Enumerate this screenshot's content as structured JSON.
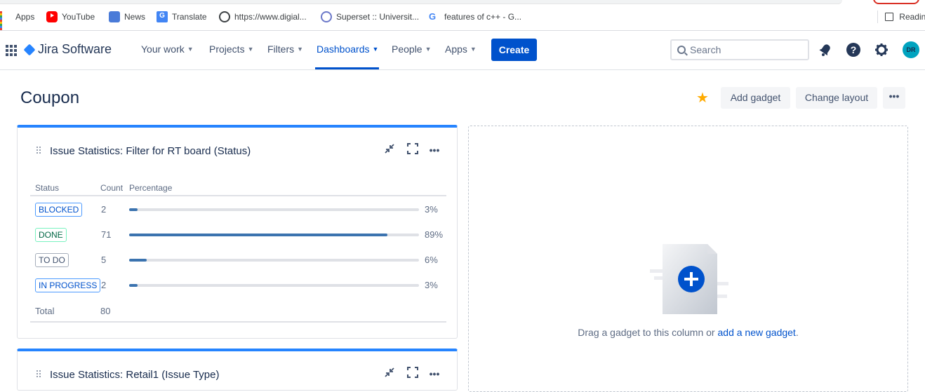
{
  "bookmarks": [
    {
      "label": "Apps",
      "icon": "apps-grid-icon"
    },
    {
      "label": "YouTube",
      "icon": "youtube-icon"
    },
    {
      "label": "News",
      "icon": "news-icon"
    },
    {
      "label": "Translate",
      "icon": "translate-icon"
    },
    {
      "label": "https://www.digial...",
      "icon": "globe-icon"
    },
    {
      "label": "Superset :: Universit...",
      "icon": "superset-icon"
    },
    {
      "label": "features of c++ - G...",
      "icon": "google-icon"
    }
  ],
  "reading_list": "Reading",
  "nav": {
    "product": "Jira Software",
    "items": [
      "Your work",
      "Projects",
      "Filters",
      "Dashboards",
      "People",
      "Apps"
    ],
    "active": "Dashboards",
    "create": "Create",
    "search_placeholder": "Search",
    "avatar_initials": "DR"
  },
  "dashboard": {
    "title": "Coupon",
    "add_gadget": "Add gadget",
    "change_layout": "Change layout",
    "more": "•••"
  },
  "gadget1": {
    "title": "Issue Statistics: Filter for RT board (Status)",
    "columns": {
      "status": "Status",
      "count": "Count",
      "percentage": "Percentage"
    },
    "rows": [
      {
        "status": "BLOCKED",
        "count": "2",
        "pct": "3%",
        "fill": 0.03,
        "style": "blue"
      },
      {
        "status": "DONE",
        "count": "71",
        "pct": "89%",
        "fill": 0.89,
        "style": "green"
      },
      {
        "status": "TO DO",
        "count": "5",
        "pct": "6%",
        "fill": 0.06,
        "style": "gray"
      },
      {
        "status": "IN PROGRESS",
        "count": "2",
        "pct": "3%",
        "fill": 0.03,
        "style": "blue"
      }
    ],
    "total_label": "Total",
    "total": "80"
  },
  "gadget2": {
    "title": "Issue Statistics: Retail1 (Issue Type)"
  },
  "empty_column": {
    "text": "Drag a gadget to this column or ",
    "link": "add a new gadget",
    "suffix": "."
  },
  "colors": {
    "accent": "#0052cc",
    "star": "#ffab00",
    "bar": "#3b73af"
  }
}
